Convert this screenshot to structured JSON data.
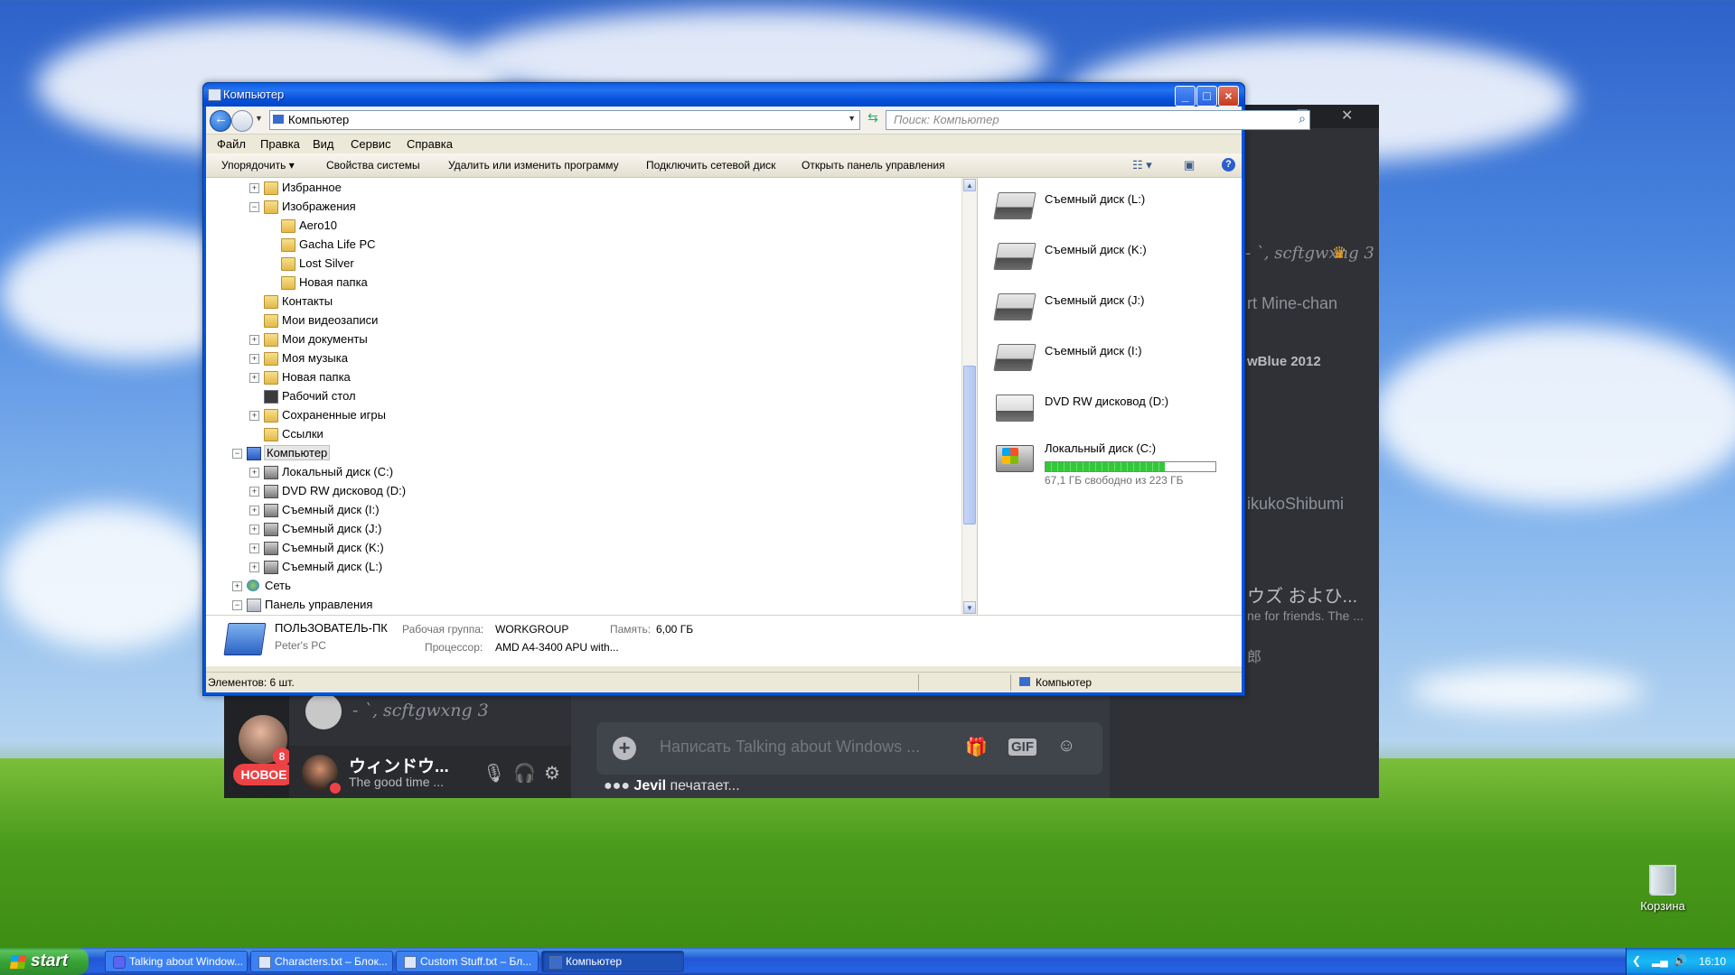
{
  "explorer": {
    "title": "Компьютер",
    "address": "Компьютер",
    "search_placeholder": "Поиск: Компьютер",
    "menu": [
      "Файл",
      "Правка",
      "Вид",
      "Сервис",
      "Справка"
    ],
    "commands": [
      "Упорядочить ▾",
      "Свойства системы",
      "Удалить или изменить программу",
      "Подключить сетевой диск",
      "Открыть панель управления"
    ],
    "tree": [
      {
        "label": "Избранное",
        "icon": "folder-icon",
        "expander": "+"
      },
      {
        "label": "Изображения",
        "icon": "folder-icon",
        "expander": "−"
      },
      {
        "label": "Aero10",
        "icon": "folder-icon",
        "expander": ""
      },
      {
        "label": "Gacha Life PC",
        "icon": "folder-icon",
        "expander": ""
      },
      {
        "label": "Lost Silver",
        "icon": "folder-icon",
        "expander": ""
      },
      {
        "label": "Новая папка",
        "icon": "folder-icon",
        "expander": ""
      },
      {
        "label": "Контакты",
        "icon": "folder-icon",
        "expander": ""
      },
      {
        "label": "Мои видеозаписи",
        "icon": "folder-icon",
        "expander": ""
      },
      {
        "label": "Мои документы",
        "icon": "folder-icon",
        "expander": "+"
      },
      {
        "label": "Моя музыка",
        "icon": "folder-icon",
        "expander": "+"
      },
      {
        "label": "Новая папка",
        "icon": "folder-icon",
        "expander": "+"
      },
      {
        "label": "Рабочий стол",
        "icon": "desktop-icon",
        "expander": ""
      },
      {
        "label": "Сохраненные игры",
        "icon": "folder-icon",
        "expander": "+"
      },
      {
        "label": "Ссылки",
        "icon": "folder-icon",
        "expander": ""
      },
      {
        "label": "Компьютер",
        "icon": "computer-icon",
        "expander": "−"
      },
      {
        "label": "Локальный диск (C:)",
        "icon": "drive-icon",
        "expander": "+"
      },
      {
        "label": "DVD RW дисковод (D:)",
        "icon": "dvd-icon",
        "expander": "+"
      },
      {
        "label": "Съемный диск (I:)",
        "icon": "drive-icon",
        "expander": "+"
      },
      {
        "label": "Съемный диск (J:)",
        "icon": "drive-icon",
        "expander": "+"
      },
      {
        "label": "Съемный диск (K:)",
        "icon": "drive-icon",
        "expander": "+"
      },
      {
        "label": "Съемный диск (L:)",
        "icon": "drive-icon",
        "expander": "+"
      },
      {
        "label": "Сеть",
        "icon": "network-icon",
        "expander": "+"
      },
      {
        "label": "Панель управления",
        "icon": "control-panel-icon",
        "expander": "−"
      }
    ],
    "drives": [
      {
        "label": "Съемный диск (L:)",
        "icon": "removable-drive-icon"
      },
      {
        "label": "Съемный диск (K:)",
        "icon": "removable-drive-icon"
      },
      {
        "label": "Съемный диск (J:)",
        "icon": "removable-drive-icon"
      },
      {
        "label": "Съемный диск (I:)",
        "icon": "removable-drive-icon"
      },
      {
        "label": "DVD RW дисковод (D:)",
        "icon": "dvd-drive-icon"
      }
    ],
    "local_disk": {
      "label": "Локальный диск (C:)",
      "free": "67,1 ГБ свободно из 223 ГБ",
      "used_fraction": 0.7
    },
    "details": {
      "pc_name": "ПОЛЬЗОВАТЕЛЬ-ПК",
      "pc_desc": "Peter's PC",
      "workgroup_label": "Рабочая группа:",
      "workgroup": "WORKGROUP",
      "memory_label": "Память:",
      "memory": "6,00 ГБ",
      "cpu_label": "Процессор:",
      "cpu": "AMD A4-3400 APU with..."
    },
    "status": {
      "items": "Элементов: 6 шт.",
      "location": "Компьютер"
    }
  },
  "discord": {
    "members": [
      "- `, scftgwxng 3",
      "rt Mine-chan",
      "wBlue 2012",
      "ikukoShibumi",
      "ウズ およひ...",
      "ne for friends. The ...",
      "郎"
    ],
    "channel_user": "- `, scftgwxng 3",
    "badge_count": "8",
    "new_label": "НОВОЕ",
    "me_name": "ウィンドウ...",
    "me_status": "The good time ...",
    "input_placeholder": "Написать Talking about Windows ...",
    "gif_label": "GIF",
    "typing_user": "Jevil",
    "typing_text": " печатает..."
  },
  "desktop": {
    "recycle_bin": "Корзина"
  },
  "taskbar": {
    "start": "start",
    "tasks": [
      {
        "label": "Talking about Window...",
        "icon": "discord-icon"
      },
      {
        "label": "Characters.txt – Блок...",
        "icon": "notepad-icon"
      },
      {
        "label": "Custom Stuff.txt – Бл...",
        "icon": "notepad-icon"
      },
      {
        "label": "Компьютер",
        "icon": "computer-icon"
      }
    ],
    "clock": "16:10"
  },
  "colors": {
    "xp_blue": "#0054e3",
    "discord_bg": "#36393f",
    "disk_bar": "#34c73c"
  }
}
